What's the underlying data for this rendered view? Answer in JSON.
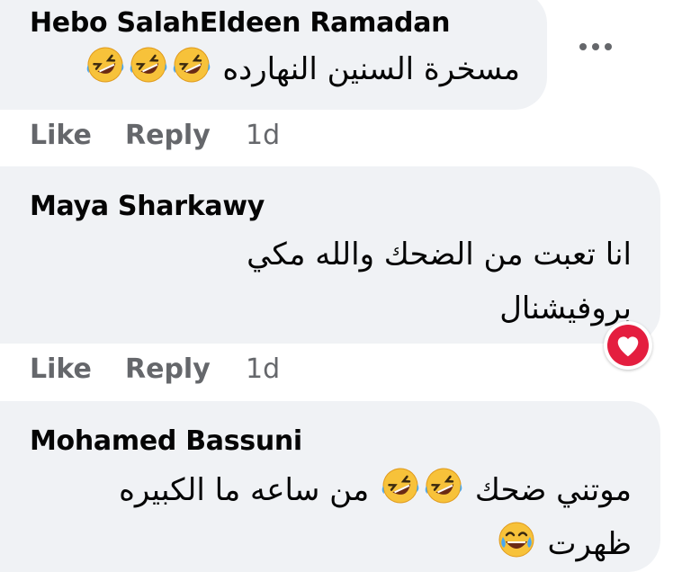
{
  "colors": {
    "bubble": "#f0f2f5",
    "meta_text": "#65676b",
    "name_text": "#050505",
    "reaction_love": "#e41e3f"
  },
  "comments": [
    {
      "author": "Hebo SalahEldeen Ramadan",
      "lines": [
        "مسخرة السنين النهارده"
      ],
      "emojis": [
        "rolling-on-floor-laughing-emoji",
        "rolling-on-floor-laughing-emoji",
        "rolling-on-floor-laughing-emoji"
      ],
      "like_label": "Like",
      "reply_label": "Reply",
      "time": "1d",
      "more_icon": "more-options-icon"
    },
    {
      "author": "Maya Sharkawy",
      "lines": [
        "انا تعبت من الضحك والله مكي",
        "بروفيشنال"
      ],
      "reaction": "heart-reaction-icon",
      "like_label": "Like",
      "reply_label": "Reply",
      "time": "1d"
    },
    {
      "author": "Mohamed Bassuni",
      "lines": [
        "موتني ضحك",
        "من ساعه ما الكبيره",
        "ظهرت"
      ],
      "emojis": [
        "rolling-on-floor-laughing-emoji",
        "rolling-on-floor-laughing-emoji",
        "face-with-tears-of-joy-emoji"
      ]
    }
  ]
}
